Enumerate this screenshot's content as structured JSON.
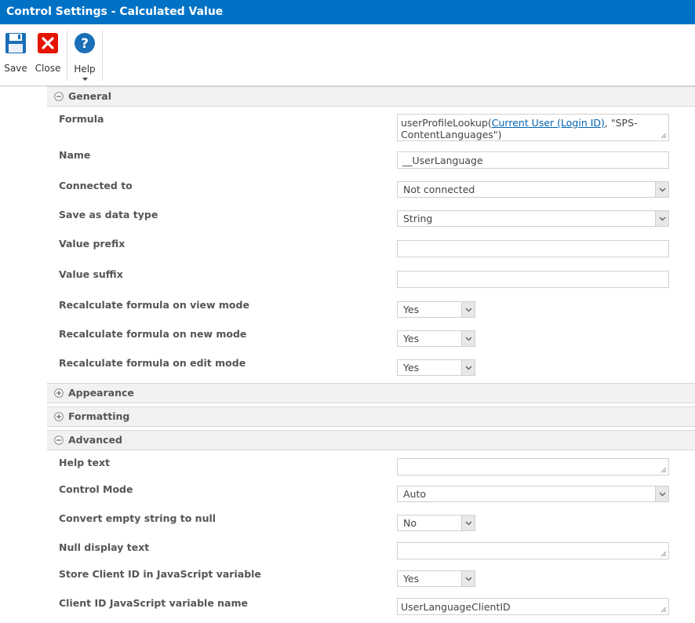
{
  "window": {
    "title": "Control Settings - Calculated Value"
  },
  "ribbon": {
    "save_label": "Save",
    "close_label": "Close",
    "help_label": "Help"
  },
  "colors": {
    "accent": "#0072c6",
    "close_red": "#e51400",
    "link": "#0063b1"
  },
  "sections": {
    "general": {
      "title": "General",
      "state": "expanded"
    },
    "appearance": {
      "title": "Appearance",
      "state": "collapsed"
    },
    "formatting": {
      "title": "Formatting",
      "state": "collapsed"
    },
    "advanced": {
      "title": "Advanced",
      "state": "expanded"
    }
  },
  "general": {
    "formula_label": "Formula",
    "formula_prefix": "userProfileLookup(",
    "formula_link": "Current User (Login ID)",
    "formula_suffix": ", \"SPS-ContentLanguages\")",
    "name_label": "Name",
    "name_value": "__UserLanguage",
    "connected_label": "Connected to",
    "connected_value": "Not connected",
    "datatype_label": "Save as data type",
    "datatype_value": "String",
    "prefix_label": "Value prefix",
    "prefix_value": "",
    "suffix_label": "Value suffix",
    "suffix_value": "",
    "recalc_view_label": "Recalculate formula on view mode",
    "recalc_view_value": "Yes",
    "recalc_new_label": "Recalculate formula on new mode",
    "recalc_new_value": "Yes",
    "recalc_edit_label": "Recalculate formula on edit mode",
    "recalc_edit_value": "Yes"
  },
  "advanced": {
    "help_label": "Help text",
    "help_value": "",
    "mode_label": "Control Mode",
    "mode_value": "Auto",
    "convert_label": "Convert empty string to null",
    "convert_value": "No",
    "null_label": "Null display text",
    "null_value": "",
    "store_label": "Store Client ID in JavaScript variable",
    "store_value": "Yes",
    "clientid_label": "Client ID JavaScript variable name",
    "clientid_value": "UserLanguageClientID"
  }
}
